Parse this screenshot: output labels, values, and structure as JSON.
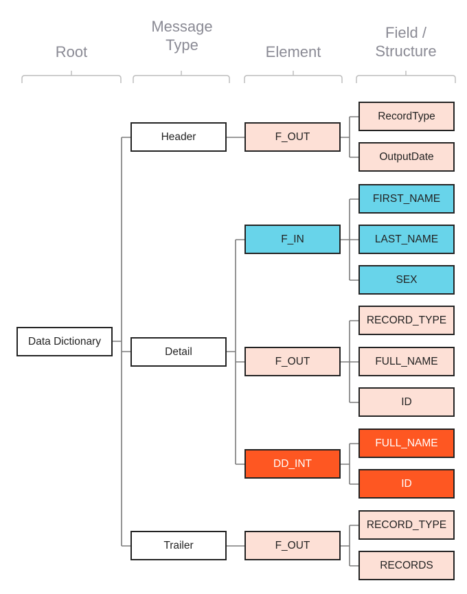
{
  "columns": [
    {
      "label": "Root"
    },
    {
      "label": "Message\nType"
    },
    {
      "label": "Element"
    },
    {
      "label": "Field /\nStructure"
    }
  ],
  "colors": {
    "default": "#ffffff",
    "output": "#fde0d6",
    "input": "#68d4ea",
    "internal": "#fe5722"
  },
  "tree": {
    "root": {
      "label": "Data Dictionary"
    },
    "message_types": [
      {
        "label": "Header"
      },
      {
        "label": "Detail"
      },
      {
        "label": "Trailer"
      }
    ],
    "elements": [
      {
        "label": "F_OUT",
        "parent": "Header",
        "kind": "output"
      },
      {
        "label": "F_IN",
        "parent": "Detail",
        "kind": "input"
      },
      {
        "label": "F_OUT",
        "parent": "Detail",
        "kind": "output"
      },
      {
        "label": "DD_INT",
        "parent": "Detail",
        "kind": "internal"
      },
      {
        "label": "F_OUT",
        "parent": "Trailer",
        "kind": "output"
      }
    ],
    "fields": [
      {
        "label": "RecordType",
        "element": 0
      },
      {
        "label": "OutputDate",
        "element": 0
      },
      {
        "label": "FIRST_NAME",
        "element": 1
      },
      {
        "label": "LAST_NAME",
        "element": 1
      },
      {
        "label": "SEX",
        "element": 1
      },
      {
        "label": "RECORD_TYPE",
        "element": 2
      },
      {
        "label": "FULL_NAME",
        "element": 2
      },
      {
        "label": "ID",
        "element": 2
      },
      {
        "label": "FULL_NAME",
        "element": 3
      },
      {
        "label": "ID",
        "element": 3
      },
      {
        "label": "RECORD_TYPE",
        "element": 4
      },
      {
        "label": "RECORDS",
        "element": 4
      }
    ]
  }
}
